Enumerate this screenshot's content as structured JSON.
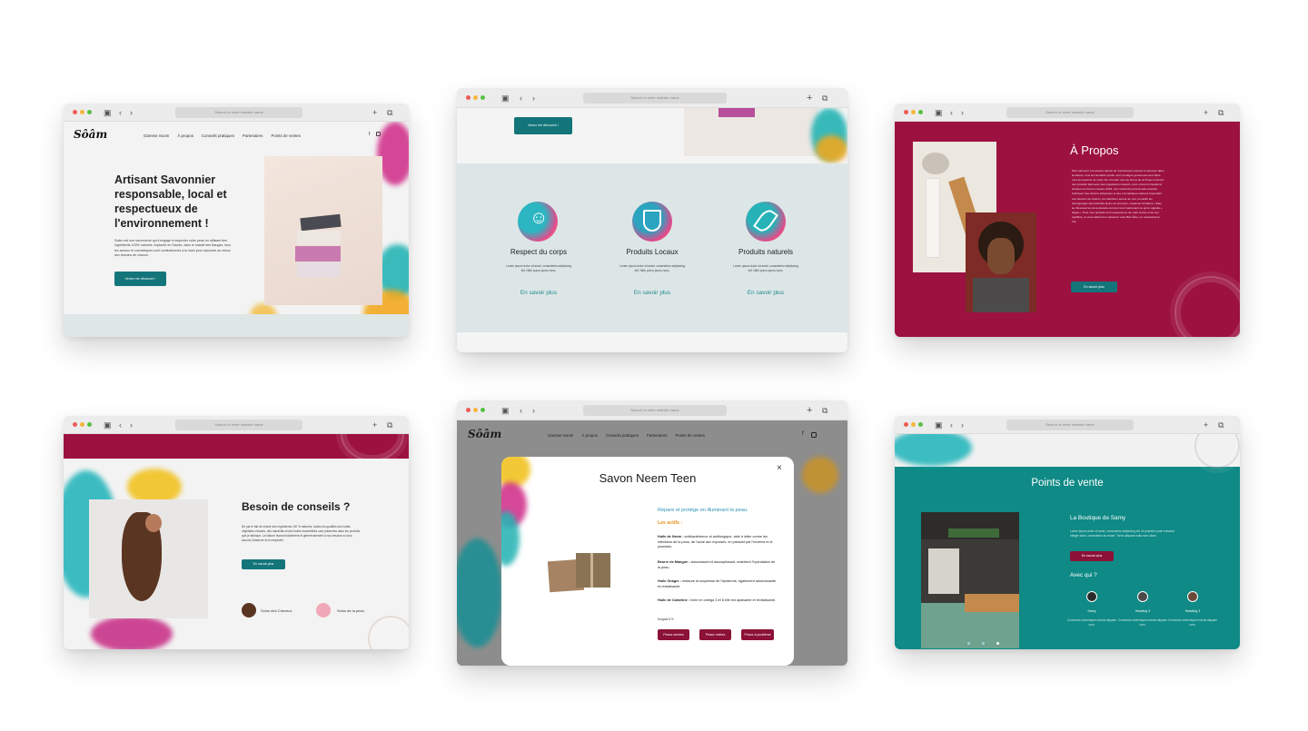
{
  "browser": {
    "address_placeholder": "Search or enter website name",
    "plus": "+"
  },
  "w1": {
    "logo": "Sôâm",
    "nav": [
      "Gamme Soom",
      "À propos",
      "Conseils pratiques",
      "Partenaires",
      "Points de ventes"
    ],
    "headline": "Artisant Savonnier responsable, local et respectueux de l'environnement !",
    "body": "Soâm est une savonnerie qui s'engage à respecter votre peau en utilisant des ingrédients 100% naturels. Implanté en Savoie, dans le massif des Bauges, tous les savons et cosmétiques sont confectionnés à la main pour répondre au mieux aux besoins de chacun.",
    "cta": "Venez me découvrir !"
  },
  "w2": {
    "cta": "Venez me découvrir !",
    "features": [
      {
        "title": "Respect du corps",
        "text": "Lorem ipsum dolor sit amet, consectetur adipiscing elit. Nibh purus purus nunc.",
        "link": "En savoir plus"
      },
      {
        "title": "Produits Locaux",
        "text": "Lorem ipsum dolor sit amet, consectetur adipiscing elit. Nibh purus purus nunc.",
        "link": "En savoir plus"
      },
      {
        "title": "Produits naturels",
        "text": "Lorem ipsum dolor sit amet, consectetur adipiscing elit. Nibh purus purus nunc.",
        "link": "En savoir plus"
      }
    ]
  },
  "w3": {
    "title": "À Propos",
    "body": "Mon parcours m'a amené depuis de nombreuses années à retrouver dans la Nature, tous les bienfaits qu'elle nous prodigue généreusement dans tous les aspects de notre Vie. Frondre soin de Soi et de sa Peau à travers des produits faits avec des ingrédients naturels, purs et des formulations simples est devenu depuis 2018, une recherche personnelle assidue. Fabriquer des savons artisanaux et des cosmétiques naturels répondant aux besoins de chacun, les distribuer autour de moi, recueillir les témoignages des bienfaits qu'ils ont procurés, respecter la Nature, l'Eau, les Ressources de la planète est pour moi maintenant ce qu'on appelle « Ikigaï ». Tous mes produits sont respectueux de votre Corps et de son équilibre, et vous aideront à maintenir votre Bien Être, en respectant la Vie.",
    "cta": "En savoir plus"
  },
  "w4": {
    "title": "Besoin de conseils ?",
    "body": "De par le fait de choisir des ingrédients 100 % naturels, toutes les qualités des huiles végétales choisies, des macérâts et des huiles essentielles sont présentes dans les produits que je fabrique. La Nature répond totalement et généreusement à nos besoins si nous savons l'observer et le respecter.",
    "cta": "En savoir plus",
    "cards": [
      "Soins des Cheveux",
      "Soins de la peau"
    ]
  },
  "w5": {
    "logo": "Sôâm",
    "nav": [
      "Gamme Soom",
      "À propos",
      "Conseils pratiques",
      "Partenaires",
      "Points de ventes"
    ],
    "modal": {
      "title": "Savon Neem Teen",
      "close": "×",
      "tagline": "Répare et protège en illuminant la peau.",
      "actifs_label": "Les actifs :",
      "actifs": [
        {
          "name": "Huile de Neem :",
          "desc": "antibactérienne et antifongique, aide à lutter contre les infections de la peau, de l'acné aux mycoses, en passant par l'eczéma et le psoriasis."
        },
        {
          "name": "Beurre de Mangue :",
          "desc": "adoucissant et assouplissant, maintient l'hydratation de la peau."
        },
        {
          "name": "Huile Onagre :",
          "desc": "restaure la souplesse de l'épiderme, également adoucissante et revitalisante"
        },
        {
          "name": "Huile de Cameline :",
          "desc": "riche en oméga 3 et 6 elle est apaisante et revitalisante."
        }
      ],
      "note": "Surgras 8 %",
      "buttons": [
        "Peaux sèches",
        "Peaux mixtes",
        "Peaux à problème"
      ]
    }
  },
  "w6": {
    "title": "Points de vente",
    "shop_name": "La Boutique de Samy",
    "shop_text": "Lorem ipsum dolor sit amet, consectetur adipiscing elit. At pharetra proin euismod integer dolor, consectetur at ornare. Tortor aliquam nulla nunc diam.",
    "cta": "En savoir plus",
    "with_title": "Avec qui ?",
    "people": [
      {
        "name": "Samy",
        "text": "Commodo scelerisque mauris aliquam cum."
      },
      {
        "name": "Heading 3",
        "text": "Commodo scelerisque mauris aliquam cum."
      },
      {
        "name": "Heading 3",
        "text": "Commodo scelerisque mauris aliquam cum."
      }
    ]
  },
  "colors": {
    "teal": "#13757a",
    "teal_bg": "#0f8a86",
    "crimson": "#9c1140",
    "modal_accent": "#2b93b5",
    "actifs_accent": "#e8901a"
  }
}
